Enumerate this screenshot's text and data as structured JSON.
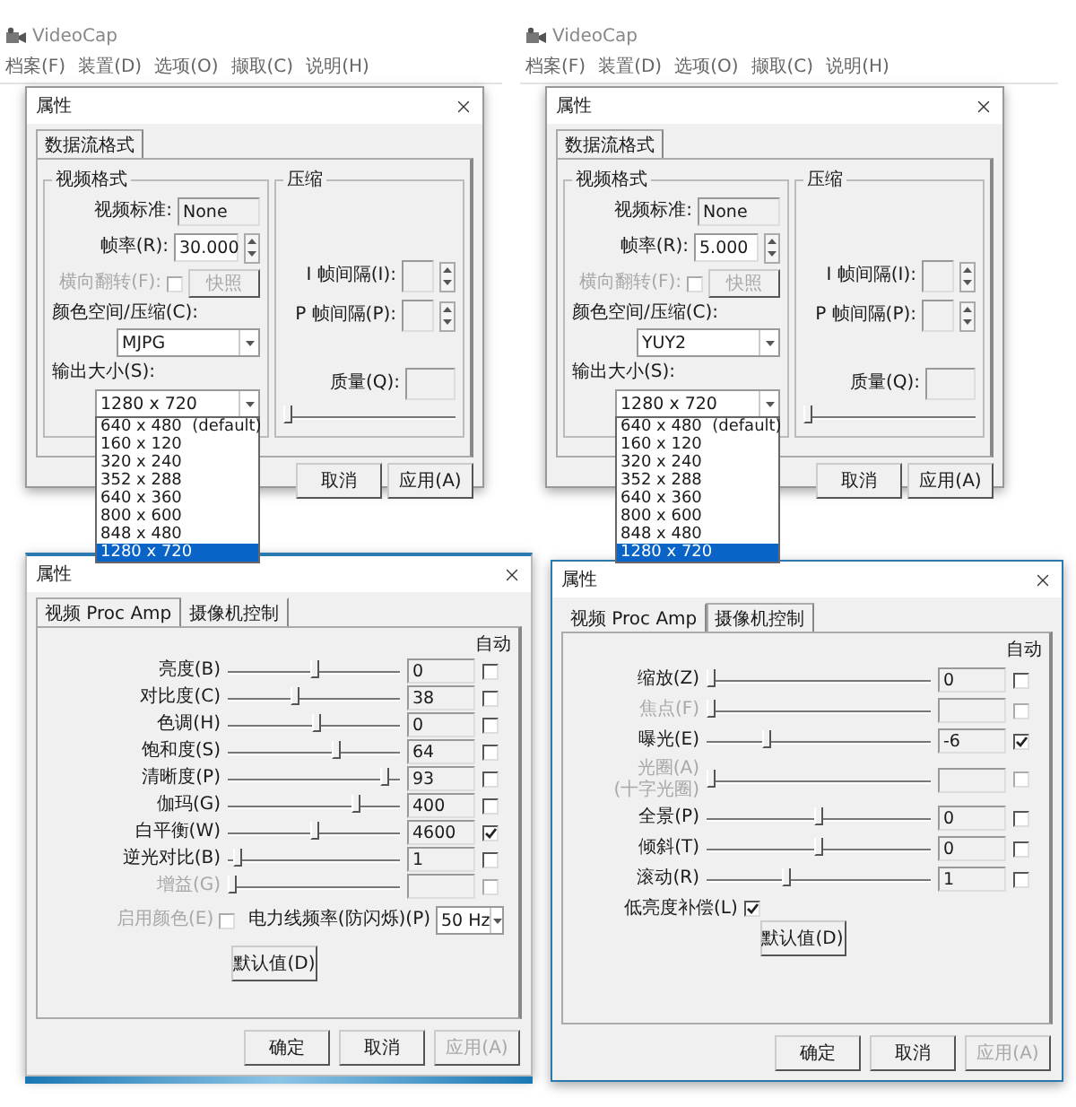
{
  "top_panels": [
    {
      "app_title": "VideoCap",
      "menu": [
        "档案(F)",
        "装置(D)",
        "选项(O)",
        "撷取(C)",
        "说明(H)"
      ],
      "dialog": {
        "title": "属性",
        "tabs": [
          {
            "label": "数据流格式",
            "selected": true
          }
        ],
        "video_format": {
          "title": "视频格式",
          "standard_label": "视频标准:",
          "standard_value": "None",
          "frame_rate_label": "帧率(R):",
          "frame_rate_value": "30.000",
          "flip_label": "横向翻转(F):",
          "flip_checked": false,
          "flip_disabled": true,
          "snapshot_button": {
            "label": "快照",
            "disabled": true
          },
          "color_space_label": "颜色空间/压缩(C):",
          "color_space_value": "MJPG",
          "output_size_label": "输出大小(S):",
          "output_size_value": "1280 x 720",
          "output_size_options": [
            {
              "label": "640 x 480  (default)",
              "selected": false
            },
            {
              "label": "160 x 120",
              "selected": false
            },
            {
              "label": "320 x 240",
              "selected": false
            },
            {
              "label": "352 x 288",
              "selected": false
            },
            {
              "label": "640 x 360",
              "selected": false
            },
            {
              "label": "800 x 600",
              "selected": false
            },
            {
              "label": "848 x 480",
              "selected": false
            },
            {
              "label": "1280 x 720",
              "selected": true
            }
          ]
        },
        "compression": {
          "title": "压缩",
          "i_frame_label": "I 帧间隔(I):",
          "p_frame_label": "P 帧间隔(P):",
          "quality_label": "质量(Q):",
          "quality_slider": {
            "level": 0
          }
        },
        "buttons": [
          "取消",
          "应用(A)"
        ]
      }
    },
    {
      "app_title": "VideoCap",
      "menu": [
        "档案(F)",
        "装置(D)",
        "选项(O)",
        "撷取(C)",
        "说明(H)"
      ],
      "dialog": {
        "title": "属性",
        "tabs": [
          {
            "label": "数据流格式",
            "selected": true
          }
        ],
        "video_format": {
          "title": "视频格式",
          "standard_label": "视频标准:",
          "standard_value": "None",
          "frame_rate_label": "帧率(R):",
          "frame_rate_value": "5.000",
          "flip_label": "横向翻转(F):",
          "flip_checked": false,
          "flip_disabled": true,
          "snapshot_button": {
            "label": "快照",
            "disabled": true
          },
          "color_space_label": "颜色空间/压缩(C):",
          "color_space_value": "YUY2",
          "output_size_label": "输出大小(S):",
          "output_size_value": "1280 x 720",
          "output_size_options": [
            {
              "label": "640 x 480  (default)",
              "selected": false
            },
            {
              "label": "160 x 120",
              "selected": false
            },
            {
              "label": "320 x 240",
              "selected": false
            },
            {
              "label": "352 x 288",
              "selected": false
            },
            {
              "label": "640 x 360",
              "selected": false
            },
            {
              "label": "800 x 600",
              "selected": false
            },
            {
              "label": "848 x 480",
              "selected": false
            },
            {
              "label": "1280 x 720",
              "selected": true
            }
          ]
        },
        "compression": {
          "title": "压缩",
          "i_frame_label": "I 帧间隔(I):",
          "p_frame_label": "P 帧间隔(P):",
          "quality_label": "质量(Q):",
          "quality_slider": {
            "level": 0
          }
        },
        "buttons": [
          "取消",
          "应用(A)"
        ]
      }
    }
  ],
  "bottom_panels": [
    {
      "title": "属性",
      "tabs": [
        {
          "label": "视频 Proc Amp",
          "selected": true
        },
        {
          "label": "摄像机控制",
          "selected": false
        }
      ],
      "auto_header": "自动",
      "rows": [
        {
          "label": "亮度(B)",
          "level": 0.5,
          "value": "0",
          "auto": false,
          "disabled": false
        },
        {
          "label": "对比度(C)",
          "level": 0.38,
          "value": "38",
          "auto": false,
          "disabled": false
        },
        {
          "label": "色调(H)",
          "level": 0.52,
          "value": "0",
          "auto": false,
          "disabled": false
        },
        {
          "label": "饱和度(S)",
          "level": 0.64,
          "value": "64",
          "auto": false,
          "disabled": false
        },
        {
          "label": "清晰度(P)",
          "level": 0.93,
          "value": "93",
          "auto": false,
          "disabled": false
        },
        {
          "label": "伽玛(G)",
          "level": 0.76,
          "value": "400",
          "auto": false,
          "disabled": false
        },
        {
          "label": "白平衡(W)",
          "level": 0.5,
          "value": "4600",
          "auto": true,
          "disabled": false
        },
        {
          "label": "逆光对比(B)",
          "level": 0.03,
          "value": "1",
          "auto": false,
          "disabled": false
        },
        {
          "label": "增益(G)",
          "level": 0.0,
          "auto": false,
          "disabled": true
        }
      ],
      "enable_color": {
        "label": "启用颜色(E)",
        "checked": false,
        "disabled": true
      },
      "power_line": {
        "label": "电力线频率(防闪烁)(P)",
        "value": "50 Hz"
      },
      "default_button": "默认值(D)",
      "buttons": [
        {
          "label": "确定",
          "disabled": false
        },
        {
          "label": "取消",
          "disabled": false
        },
        {
          "label": "应用(A)",
          "disabled": true
        }
      ]
    },
    {
      "title": "属性",
      "tabs": [
        {
          "label": "视频 Proc Amp",
          "selected": false
        },
        {
          "label": "摄像机控制",
          "selected": true
        }
      ],
      "auto_header": "自动",
      "rows": [
        {
          "label": "缩放(Z)",
          "level": 0.0,
          "value": "0",
          "auto": false,
          "disabled": false
        },
        {
          "label": "焦点(F)",
          "level": 0.0,
          "auto": false,
          "disabled": true
        },
        {
          "label": "曝光(E)",
          "level": 0.26,
          "value": "-6",
          "auto": true,
          "disabled": false
        },
        {
          "label": "光圈(A)",
          "sublabel": "(十字光圈)",
          "level": 0.0,
          "auto": false,
          "disabled": true
        },
        {
          "label": "全景(P)",
          "level": 0.5,
          "value": "0",
          "auto": false,
          "disabled": false
        },
        {
          "label": "倾斜(T)",
          "level": 0.5,
          "value": "0",
          "auto": false,
          "disabled": false
        },
        {
          "label": "滚动(R)",
          "level": 0.35,
          "value": "1",
          "auto": false,
          "disabled": false
        }
      ],
      "low_light": {
        "label": "低亮度补偿(L)",
        "checked": true
      },
      "default_button": "默认值(D)",
      "buttons": [
        {
          "label": "确定",
          "disabled": false
        },
        {
          "label": "取消",
          "disabled": false
        },
        {
          "label": "应用(A)",
          "disabled": true
        }
      ]
    }
  ]
}
